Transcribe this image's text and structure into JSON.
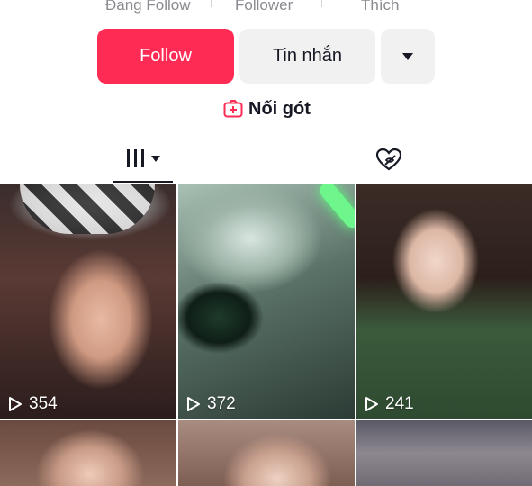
{
  "profile_stats": {
    "following_label": "Đang Follow",
    "followers_label": "Follower",
    "likes_label": "Thích"
  },
  "actions": {
    "follow_label": "Follow",
    "message_label": "Tin nhắn"
  },
  "link": {
    "label": "Nối gót"
  },
  "colors": {
    "accent": "#fe2c55",
    "secondary_button": "#f1f1f2",
    "text": "#161823"
  },
  "icons": {
    "more": "chevron-down-icon",
    "link": "add-duet-icon",
    "videos_tab": "grid-bars-icon",
    "liked_tab": "heart-hidden-icon",
    "views": "play-icon"
  },
  "videos": [
    {
      "views": "354"
    },
    {
      "views": "372"
    },
    {
      "views": "241"
    },
    {
      "views": ""
    },
    {
      "views": ""
    },
    {
      "views": ""
    }
  ]
}
